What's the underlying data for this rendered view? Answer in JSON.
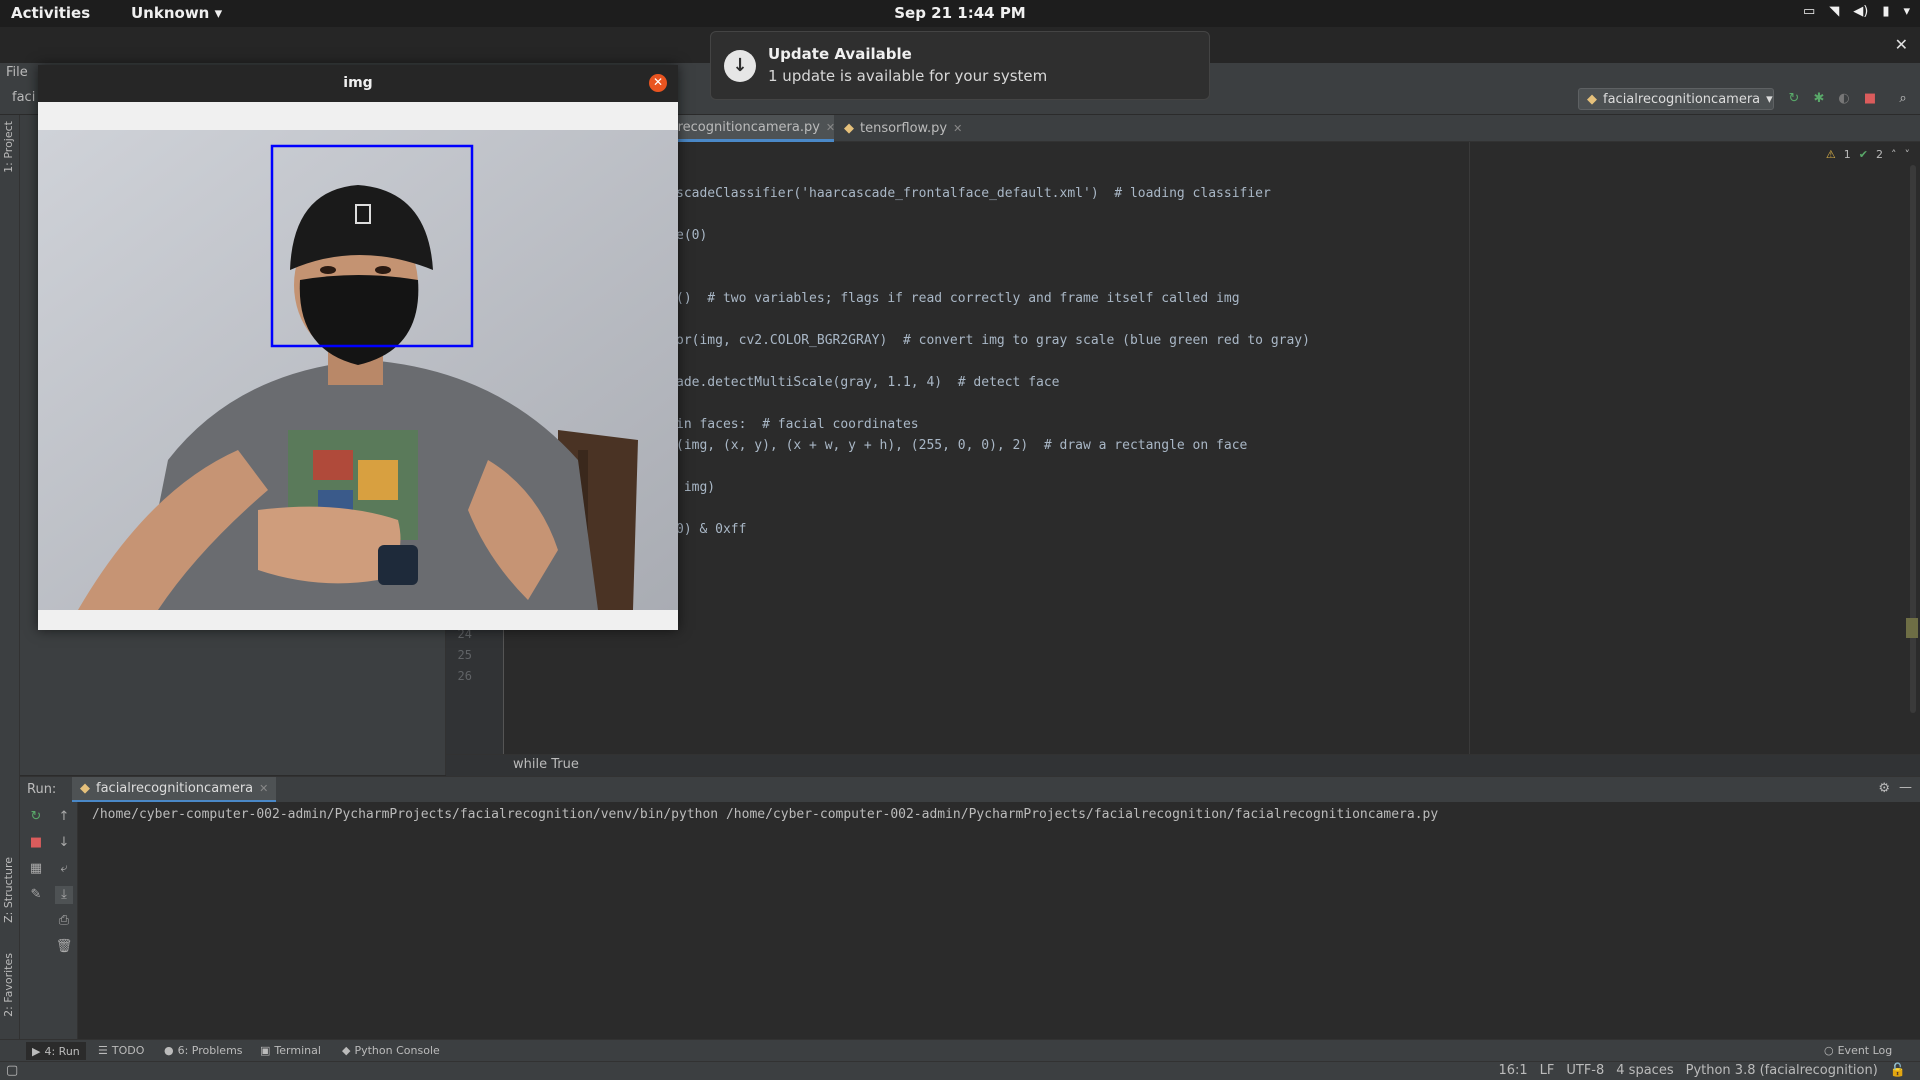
{
  "topbar": {
    "activities": "Activities",
    "app_menu": "Unknown ▾",
    "clock": "Sep 21  1:44 PM",
    "tray_icons": [
      "display-icon",
      "wifi-icon",
      "volume-icon",
      "battery-icon",
      "chevron-down-icon"
    ]
  },
  "notification": {
    "title": "Update Available",
    "body": "1 update is available for your system",
    "icon": "download-icon"
  },
  "ide": {
    "menu": {
      "file": "File"
    },
    "project_name": "faci",
    "run_config": "facialrecognitioncamera",
    "tabs": [
      {
        "label": "alrecognitioncamera.py",
        "active": true
      },
      {
        "label": "tensorflow.py",
        "active": false
      }
    ],
    "inspections": {
      "warnings": "1",
      "weak_warnings": "2"
    },
    "code_lines": [
      {
        "text": "scadeClassifier('haarcascade_frontalface_default.xml')  # loading classifier"
      },
      {
        "text": "e(0)"
      },
      {
        "text": "()  # two variables; flags if read correctly and frame itself called img"
      },
      {
        "text": "or(img, cv2.COLOR_BGR2GRAY)  # convert img to gray scale (blue green red to gray)"
      },
      {
        "text": "ade.detectMultiScale(gray, 1.1, 4)  # detect face"
      },
      {
        "text": "in faces:  # facial coordinates"
      },
      {
        "text": "(img, (x, y), (x + w, y + h), (255, 0, 0), 2)  # draw a rectangle on face"
      },
      {
        "text": " img)"
      },
      {
        "text": "0) & 0xff"
      }
    ],
    "line_numbers": [
      "24",
      "25",
      "26"
    ],
    "breadcrumb": "while True",
    "left_tabs": {
      "project": "1: Project",
      "structure": "Z: Structure",
      "favorites": "2: Favorites"
    }
  },
  "run": {
    "label": "Run:",
    "tab": "facialrecognitioncamera",
    "console": "/home/cyber-computer-002-admin/PycharmProjects/facialrecognition/venv/bin/python /home/cyber-computer-002-admin/PycharmProjects/facialrecognition/facialrecognitioncamera.py"
  },
  "bottom_tools": {
    "run": "4: Run",
    "todo": "TODO",
    "problems": "6: Problems",
    "terminal": "Terminal",
    "python_console": "Python Console",
    "event_log": "Event Log"
  },
  "status": {
    "position": "16:1",
    "line_sep": "LF",
    "encoding": "UTF-8",
    "indent": "4 spaces",
    "interpreter": "Python 3.8 (facialrecognition)"
  },
  "img_window": {
    "title": "img"
  },
  "colors": {
    "accent": "#4a88c7",
    "close_button": "#e95420",
    "detection_box": "#0000ff"
  }
}
